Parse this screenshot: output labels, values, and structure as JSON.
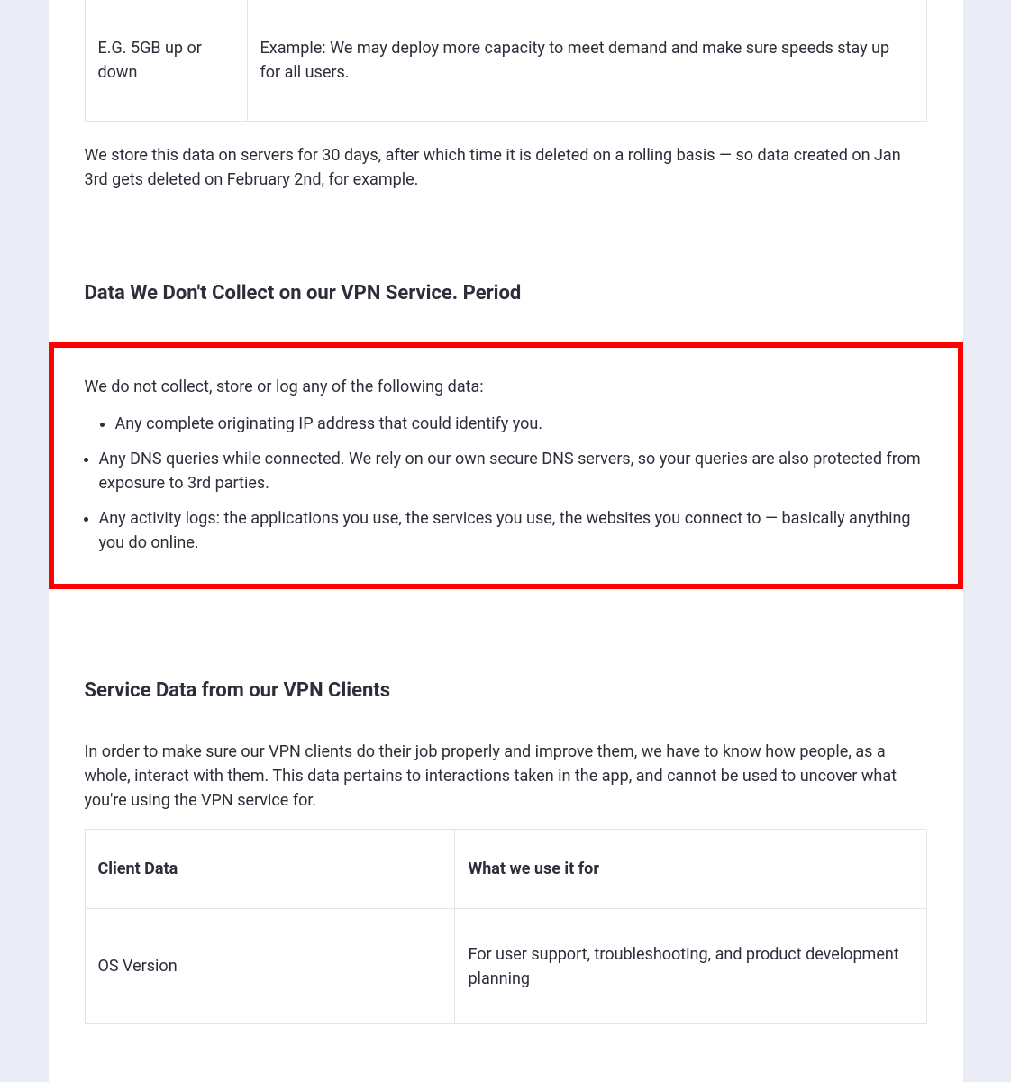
{
  "table_top": {
    "left": "E.G. 5GB up or down",
    "right": "Example: We may deploy more capacity to meet demand and make sure speeds stay up for all users."
  },
  "storage_note": "We store this data on servers for 30 days, after which time it is deleted on a rolling basis — so data created on Jan 3rd gets deleted on February 2nd, for example.",
  "section_not_collect": {
    "heading": "Data We Don't Collect on our VPN Service. Period",
    "intro": "We do not collect, store or log any of the following data:",
    "item1": "Any complete originating IP address that could identify you.",
    "item2": "Any DNS queries while connected. We rely on our own secure DNS servers, so your queries are also protected from exposure to 3rd parties.",
    "item3": "Any activity logs: the applications you use, the services you use, the websites you connect to — basically anything you do online."
  },
  "section_clients": {
    "heading": "Service Data from our VPN Clients",
    "intro": "In order to make sure our VPN clients do their job properly and improve them, we have to know how people, as a whole, interact with them. This data pertains to interactions taken in the app, and cannot be used to uncover what you're using the VPN service for.",
    "th1": "Client Data",
    "th2": "What we use it for",
    "row1_left": "OS Version",
    "row1_right": "For user support, troubleshooting, and product development planning"
  }
}
